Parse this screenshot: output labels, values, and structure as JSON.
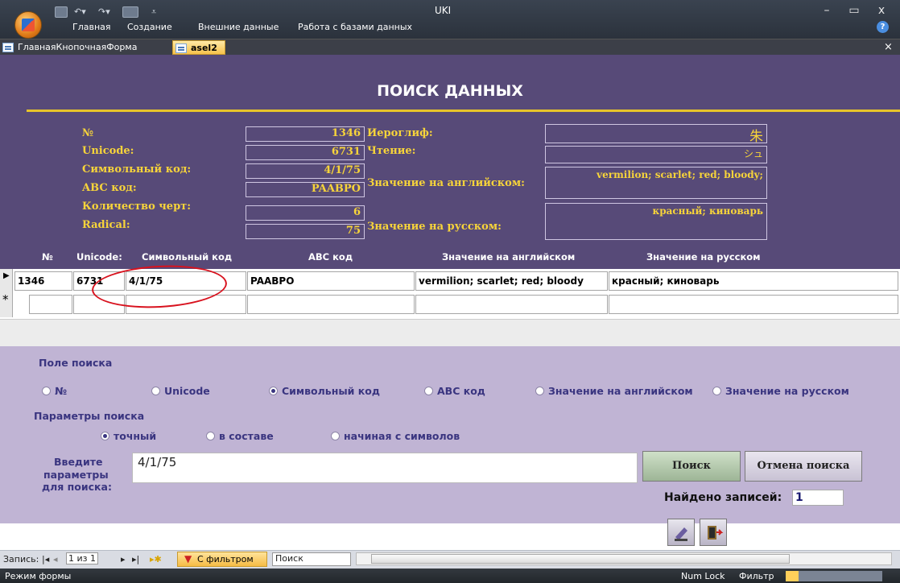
{
  "window": {
    "title": "UKI",
    "controls": [
      "–",
      "▭",
      "x"
    ]
  },
  "ribbon": {
    "tabs": [
      "Главная",
      "Создание",
      "Внешние данные",
      "Работа с базами данных"
    ],
    "help_label": "?"
  },
  "doc_tabs": {
    "tab1": "ГлавнаяКнопочнаяФорма",
    "tab2": "asel2",
    "close": "×"
  },
  "form": {
    "title": "ПОИСК ДАННЫХ",
    "labels": {
      "num": "№",
      "unicode": "Unicode:",
      "symcode": "Символьный код:",
      "abc": "ABC код:",
      "strokes": "Количество черт:",
      "radical": "Radical:",
      "hieroglyph": "Иероглиф:",
      "reading": "Чтение:",
      "meaning_en": "Значение на английском:",
      "meaning_ru": "Значение на русском:"
    },
    "values": {
      "num": "1346",
      "unicode": "6731",
      "symcode": "4/1/75",
      "abc": "PAABPO",
      "strokes": "6",
      "radical": "75",
      "hieroglyph": "朱",
      "reading": "シュ",
      "meaning_en": "vermilion; scarlet; red; bloody;",
      "meaning_ru": "красный; киноварь"
    }
  },
  "grid": {
    "headers": [
      "№",
      "Unicode:",
      "Символьный код",
      "ABC код",
      "Значение на английском",
      "Значение на русском"
    ],
    "row": [
      "1346",
      "6731",
      "4/1/75",
      "PAABPO",
      "vermilion; scarlet; red; bloody",
      "красный; киноварь"
    ],
    "row_marker": "▶",
    "new_marker": "*"
  },
  "search": {
    "field_group_label": "Поле поиска",
    "fields": [
      "№",
      "Unicode",
      "Символьный код",
      "ABC код",
      "Значение на английском",
      "Значение на русском"
    ],
    "selected_field": "Символьный код",
    "params_label": "Параметры поиска",
    "params": [
      "точный",
      "в составе",
      "начиная с символов"
    ],
    "selected_param": "точный",
    "input_label_1": "Введите",
    "input_label_2": "параметры",
    "input_label_3": "для поиска:",
    "input_value": "4/1/75",
    "search_button": "Поиск",
    "cancel_button": "Отмена поиска",
    "found_label": "Найдено записей:",
    "found_value": "1"
  },
  "navbar": {
    "record_label": "Запись:",
    "record_pos": "1 из 1",
    "filter_label": "С фильтром",
    "search_label": "Поиск"
  },
  "status": {
    "mode": "Режим формы",
    "numlock": "Num Lock",
    "filter": "Фильтр"
  },
  "colors": {
    "form_bg": "#574a78",
    "label_gold": "#f7d43a",
    "search_bg": "#c0b4d4",
    "annotation": "#d8121e"
  }
}
